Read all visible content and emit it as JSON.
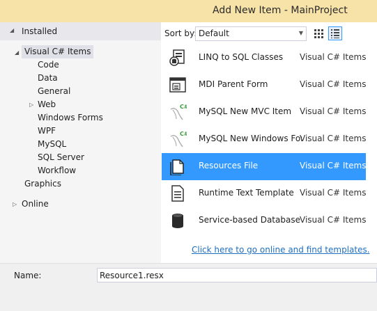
{
  "window": {
    "title": "Add New Item - MainProject"
  },
  "tree": {
    "installed_label": "Installed",
    "root_label": "Visual C# Items",
    "children": [
      "Code",
      "Data",
      "General",
      "Web",
      "Windows Forms",
      "WPF",
      "MySQL",
      "SQL Server",
      "Workflow"
    ],
    "graphics_label": "Graphics",
    "online_label": "Online"
  },
  "sort": {
    "label": "Sort by:",
    "value": "Default"
  },
  "templates": [
    {
      "name": "LINQ to SQL Classes",
      "category": "Visual C# Items",
      "icon": "linq-icon",
      "selected": false
    },
    {
      "name": "MDI Parent Form",
      "category": "Visual C# Items",
      "icon": "mdi-form-icon",
      "selected": false
    },
    {
      "name": "MySQL New MVC Item",
      "category": "Visual C# Items",
      "icon": "mysql-dolphin-icon",
      "selected": false
    },
    {
      "name": "MySQL New Windows For...",
      "category": "Visual C# Items",
      "icon": "mysql-dolphin-icon",
      "selected": false
    },
    {
      "name": "Resources File",
      "category": "Visual C# Items",
      "icon": "resource-file-icon",
      "selected": true
    },
    {
      "name": "Runtime Text Template",
      "category": "Visual C# Items",
      "icon": "text-template-icon",
      "selected": false
    },
    {
      "name": "Service-based Database",
      "category": "Visual C# Items",
      "icon": "database-icon",
      "selected": false
    }
  ],
  "online_link": "Click here to go online and find templates.",
  "name_field": {
    "label": "Name:",
    "value": "Resource1.resx"
  },
  "colors": {
    "title_bar": "#f7e3a8",
    "selection": "#3399ff",
    "link": "#1e6fc0"
  }
}
